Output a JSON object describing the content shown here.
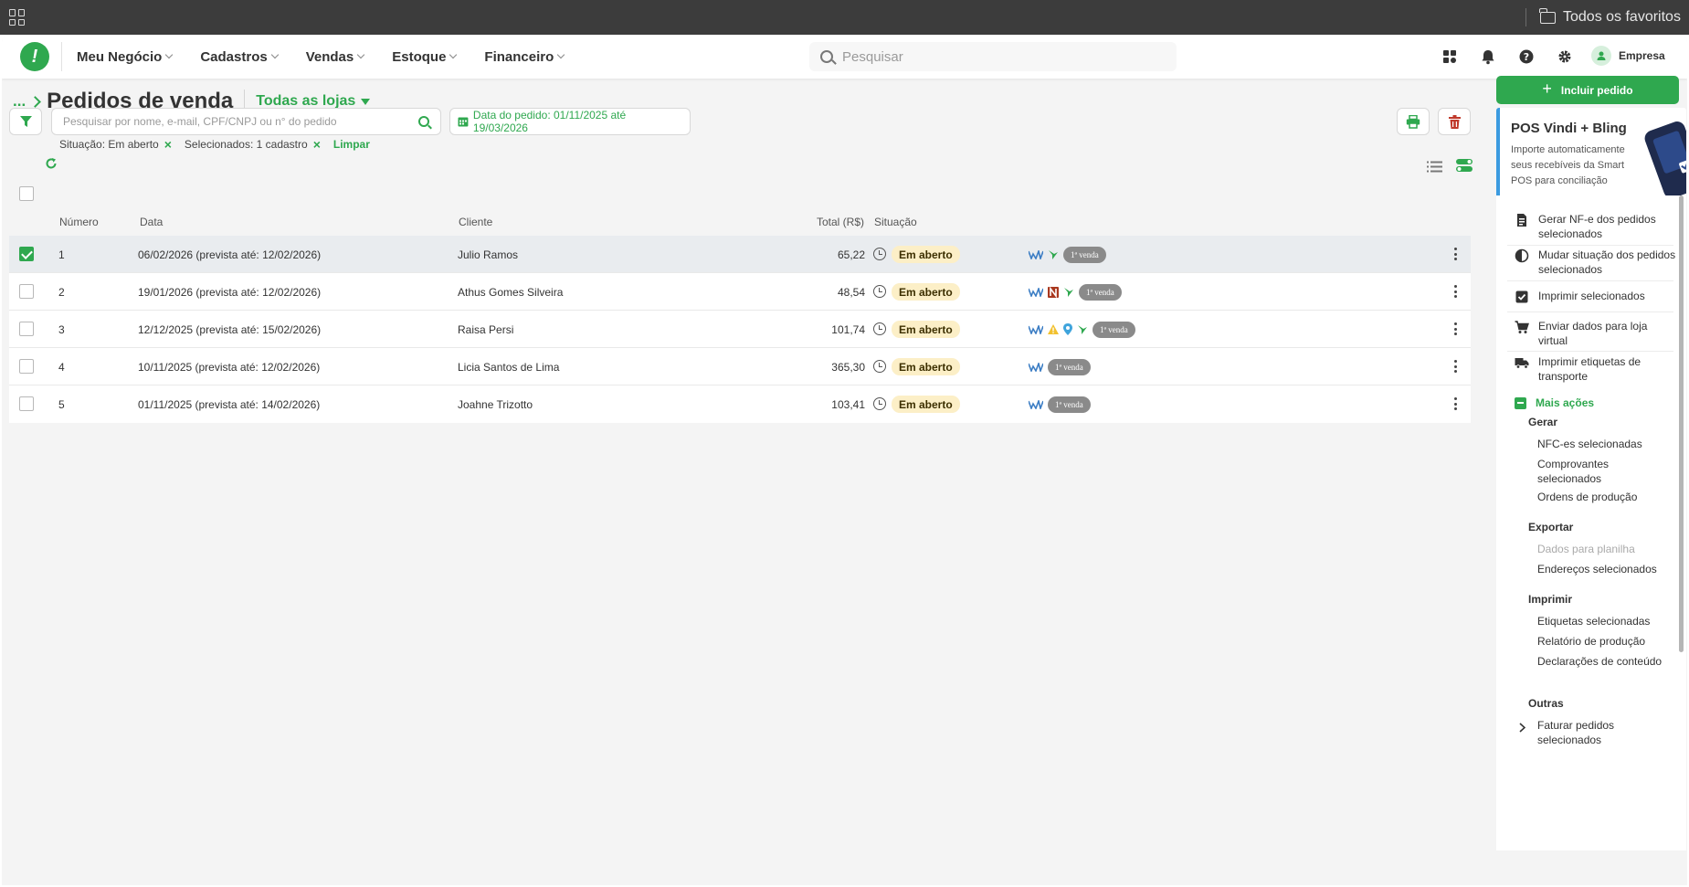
{
  "browser": {
    "favorites_label": "Todos os favoritos"
  },
  "header": {
    "logo_glyph": "!",
    "nav": [
      "Meu Negócio",
      "Cadastros",
      "Vendas",
      "Estoque",
      "Financeiro"
    ],
    "search_placeholder": "Pesquisar",
    "user_label": "Empresa",
    "accent_color": "#2fa84f"
  },
  "page": {
    "breadcrumb": "...",
    "title": "Pedidos de venda",
    "store_selector": "Todas as lojas",
    "search_placeholder": "Pesquisar por nome, e-mail, CPF/CNPJ ou n° do pedido",
    "date_filter": "Data do pedido: 01/11/2025 até 19/03/2026",
    "chips": [
      "Situação: Em aberto",
      "Selecionados: 1 cadastro"
    ],
    "clear_label": "Limpar"
  },
  "table": {
    "columns": [
      "Número",
      "Data",
      "Cliente",
      "Total (R$)",
      "Situação"
    ],
    "rows": [
      {
        "numero": "1",
        "data": "06/02/2026 (prevista até: 12/02/2026)",
        "cliente": "Julio Ramos",
        "total": "65,22",
        "situacao": "Em aberto",
        "badge": "1ª venda",
        "selected": true
      },
      {
        "numero": "2",
        "data": "19/01/2026 (prevista até: 12/02/2026)",
        "cliente": "Athus Gomes Silveira",
        "total": "48,54",
        "situacao": "Em aberto",
        "badge": "1ª venda",
        "selected": false
      },
      {
        "numero": "3",
        "data": "12/12/2025 (prevista até: 15/02/2026)",
        "cliente": "Raisa Persi",
        "total": "101,74",
        "situacao": "Em aberto",
        "badge": "1ª venda",
        "selected": false
      },
      {
        "numero": "4",
        "data": "10/11/2025 (prevista até: 12/02/2026)",
        "cliente": "Licia Santos de Lima",
        "total": "365,30",
        "situacao": "Em aberto",
        "badge": "1ª venda",
        "selected": false
      },
      {
        "numero": "5",
        "data": "01/11/2025 (prevista até: 14/02/2026)",
        "cliente": "Joahne Trizotto",
        "total": "103,41",
        "situacao": "Em aberto",
        "badge": "1ª venda",
        "selected": false
      }
    ]
  },
  "sidebar": {
    "include_button": "Incluir pedido",
    "promo_title": "POS Vindi + Bling",
    "promo_text": "Importe automaticamente seus recebíveis da Smart POS para conciliação",
    "actions": [
      "Gerar NF-e dos pedidos selecionados",
      "Mudar situação dos pedidos selecionados",
      "Imprimir selecionados",
      "Enviar dados para loja virtual",
      "Imprimir etiquetas de transporte"
    ],
    "more_actions": "Mais ações",
    "groups": {
      "gerar": {
        "title": "Gerar",
        "items": [
          "NFC-es selecionadas",
          "Comprovantes selecionados",
          "Ordens de produção"
        ]
      },
      "exportar": {
        "title": "Exportar",
        "items": [
          "Dados para planilha",
          "Endereços selecionados"
        ]
      },
      "imprimir": {
        "title": "Imprimir",
        "items": [
          "Etiquetas selecionadas",
          "Relatório de produção",
          "Declarações de conteúdo"
        ]
      },
      "outras": {
        "title": "Outras",
        "items": [
          "Faturar pedidos selecionados"
        ]
      }
    }
  }
}
